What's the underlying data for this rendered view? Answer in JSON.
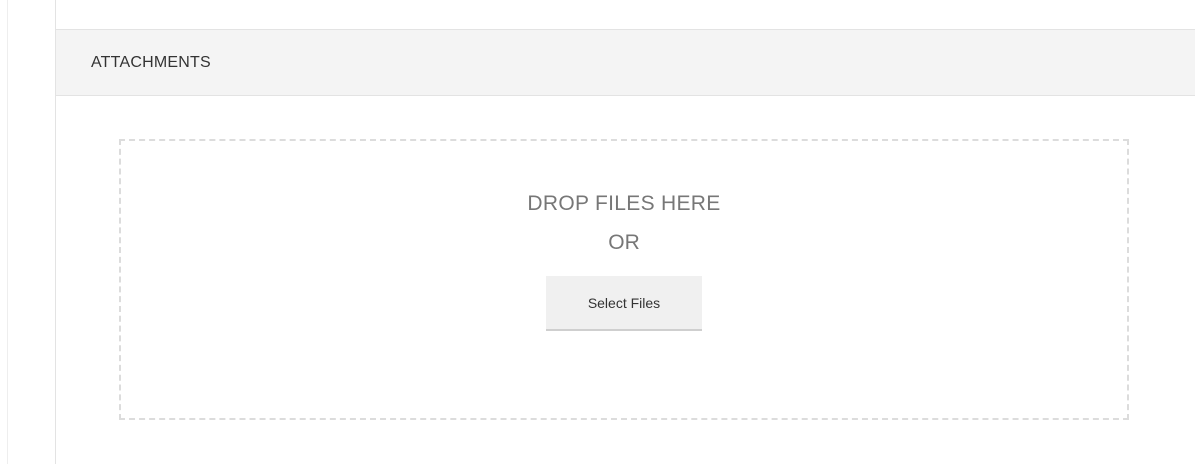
{
  "attachments": {
    "title": "ATTACHMENTS",
    "dropzone": {
      "line1": "DROP FILES HERE",
      "line2": "OR",
      "select_label": "Select Files"
    }
  },
  "colors": {
    "header_bg": "#f4f4f4",
    "border": "#e3e3e3",
    "dashed_border": "#dcdcdc",
    "dropzone_text": "#777777",
    "button_bg": "#f0f0f0"
  }
}
